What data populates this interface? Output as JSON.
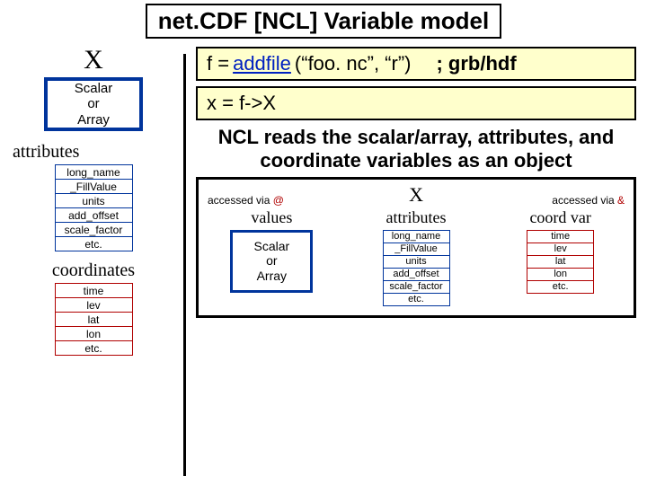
{
  "title": "net.CDF [NCL] Variable model",
  "left": {
    "x": "X",
    "scalar": "Scalar\nor\nArray",
    "attributes_h": "attributes",
    "attributes": [
      "long_name",
      "_FillValue",
      "units",
      "add_offset",
      "scale_factor",
      "etc."
    ],
    "coords_h": "coordinates",
    "coords": [
      "time",
      "lev",
      "lat",
      "lon",
      "etc."
    ]
  },
  "code": {
    "line1_pre": "f = ",
    "addfile": "addfile",
    "line1_args": "(“foo. nc”, “r”)",
    "grb": "; grb/hdf",
    "line2": "x = f->X"
  },
  "explain": "NCL reads the scalar/array, attributes, and coordinate variables as an object",
  "object": {
    "x": "X",
    "accessed_at_pre": "accessed via ",
    "at": "@",
    "accessed_amp_pre": "accessed via ",
    "amp": "&",
    "values_h": "values",
    "values_box": "Scalar\nor\nArray",
    "attrs_h": "attributes",
    "attrs": [
      "long_name",
      "_FillValue",
      "units",
      "add_offset",
      "scale_factor",
      "etc."
    ],
    "coord_h": "coord var",
    "coords": [
      "time",
      "lev",
      "lat",
      "lon",
      "etc."
    ]
  }
}
